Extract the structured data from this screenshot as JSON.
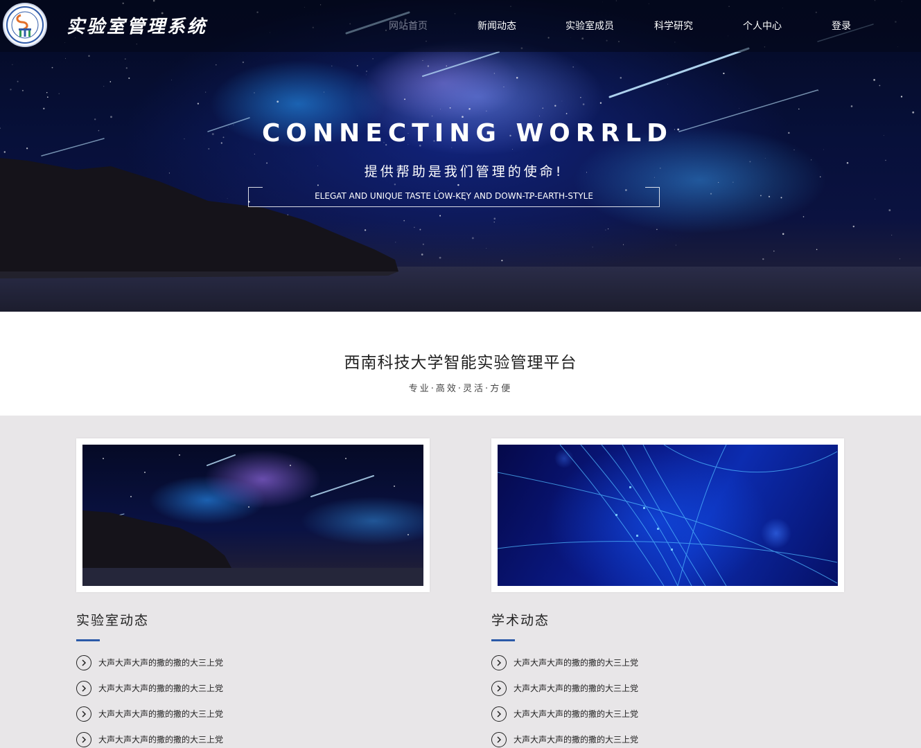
{
  "header": {
    "site_title": "实验室管理系统",
    "nav": [
      {
        "label": "网站首页",
        "active": true
      },
      {
        "label": "新闻动态",
        "active": false
      },
      {
        "label": "实验室成员",
        "active": false
      },
      {
        "label": "科学研究",
        "active": false
      },
      {
        "label": "个人中心",
        "active": false
      },
      {
        "label": "登录",
        "active": false
      }
    ]
  },
  "hero": {
    "title": "CONNECTING WORRLD",
    "subtitle": "提供帮助是我们管理的使命!",
    "tagline": "ELEGAT AND UNIQUE TASTE LOW-KEY AND DOWN-TP-EARTH-STYLE"
  },
  "intro": {
    "title": "西南科技大学智能实验管理平台",
    "subtitle": "专业·高效·灵活·方便"
  },
  "sections": [
    {
      "heading": "实验室动态",
      "items": [
        "大声大声大声的撒的撒的大三上党",
        "大声大声大声的撒的撒的大三上党",
        "大声大声大声的撒的撒的大三上党",
        "大声大声大声的撒的撒的大三上党"
      ]
    },
    {
      "heading": "学术动态",
      "items": [
        "大声大声大声的撒的撒的大三上党",
        "大声大声大声的撒的撒的大三上党",
        "大声大声大声的撒的撒的大三上党",
        "大声大声大声的撒的撒的大三上党"
      ]
    }
  ],
  "colors": {
    "accent": "#2b5aa8",
    "nav_active": "#7a7f92",
    "section_bg": "#e8e6e8"
  }
}
